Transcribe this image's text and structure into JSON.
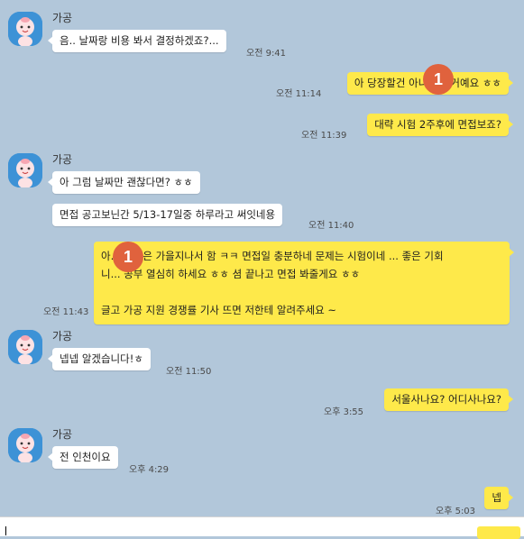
{
  "sender_name": "가공",
  "messages": {
    "m1": {
      "text": "음.. 날짜랑 비용 봐서 결정하겠죠?...",
      "time": "오전 9:41"
    },
    "m2": {
      "text": "아 당장할건 아니고... 거예요 ㅎㅎ",
      "time": "오전 11:14"
    },
    "m3": {
      "text": "대략 시험 2주후에 면접보죠?",
      "time": "오전 11:39"
    },
    "m4": {
      "text": "아 그럼 날짜만 괜찮다면? ㅎㅎ",
      "time": ""
    },
    "m5": {
      "text": "면접 공고보닌간 5/13-17일중 하루라고 써잇네용",
      "time": "오전 11:40"
    },
    "m6": {
      "line1": "아... 특강은 가을지나서 함 ㅋㅋ 면접일 충분하네 문제는 시험이네 ... 좋은 기회",
      "line2": "니... 공부 열심히 하세요 ㅎㅎ 셤 끝나고 면접 봐줄게요 ㅎㅎ",
      "line3": "글고 가공 지원 경쟁률 기사 뜨면 저한테 알려주세요 ~",
      "time": "오전 11:43"
    },
    "m7": {
      "text": "넵넵 알겠습니다!ㅎ",
      "time": "오전 11:50"
    },
    "m8": {
      "text": "서울사나요? 어디사나요?",
      "time": "오후 3:55"
    },
    "m9": {
      "text": "전 인천이요",
      "time": "오후 4:29"
    },
    "m10": {
      "text": "넵",
      "time": "오후 5:03"
    }
  },
  "badges": {
    "b1": "1",
    "b2": "1"
  },
  "colors": {
    "background": "#b2c7da",
    "outgoing": "#fee94a",
    "incoming": "#ffffff",
    "badge": "#e0623d",
    "avatar": "#3d92d6"
  },
  "icons": {
    "avatar": "peach-character-icon"
  }
}
